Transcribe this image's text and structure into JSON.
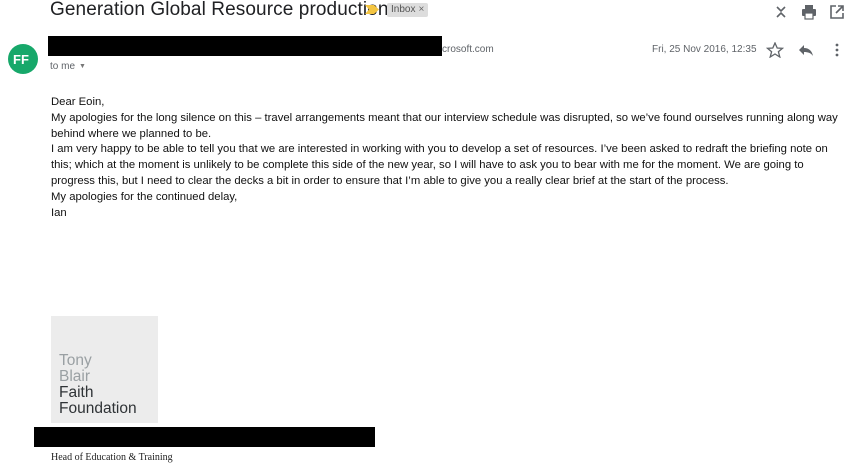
{
  "email": {
    "subject": "Generation Global Resource production",
    "label_badge": "Inbox",
    "label_badge_close": "×",
    "sender_domain_visible": "crosoft.com",
    "recipient": "to me",
    "date": "Fri, 25 Nov 2016, 12:35",
    "avatar_initials": "FF"
  },
  "body": {
    "greeting": "Dear Eoin,",
    "paragraphs": [
      "My apologies for the long silence on this – travel arrangements meant that our interview schedule was disrupted, so we’ve found ourselves running along way behind where we planned to be.",
      "I am very happy to be able to tell you that we are interested in working with you to develop a set of resources. I’ve been asked to redraft the briefing note on this; which at the moment is unlikely to be complete this side of the new year, so I will have to ask you to bear with me for the moment. We are going to progress this, but I need to clear the decks a bit in order to ensure that I’m able to give you a really clear brief at the start of the process.",
      "My apologies for the continued delay,"
    ],
    "signoff": "Ian"
  },
  "signature": {
    "logo_lines": [
      "Tony",
      "Blair",
      "Faith",
      "Foundation"
    ],
    "title": "Head of Education & Training"
  },
  "icons": {
    "toolbar": [
      "expand-collapse-icon",
      "print-icon",
      "open-in-new-window-icon"
    ],
    "row": [
      "star-icon",
      "reply-icon",
      "more-options-icon"
    ],
    "avatar_color": "#17a86a",
    "important_marker_color": "#f4c542"
  }
}
